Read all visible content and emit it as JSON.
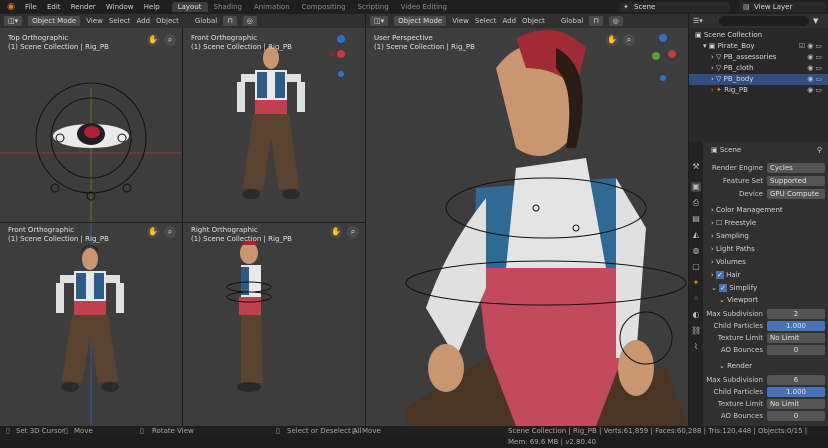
{
  "menu": [
    "File",
    "Edit",
    "Render",
    "Window",
    "Help"
  ],
  "workspaces": [
    {
      "label": "Layout",
      "active": true
    },
    {
      "label": "Shading",
      "active": false
    },
    {
      "label": "Animation",
      "active": false
    },
    {
      "label": "Compositing",
      "active": false
    },
    {
      "label": "Scripting",
      "active": false
    },
    {
      "label": "Video Editing",
      "active": false
    }
  ],
  "scene_name": "Scene",
  "view_layer": "View Layer",
  "viewport_header": {
    "mode": "Object Mode",
    "view": "View",
    "select": "Select",
    "add": "Add",
    "object": "Object",
    "orientation": "Global"
  },
  "viewports": {
    "top": {
      "name": "Top Orthographic",
      "collection": "(1) Scene Collection | Rig_PB"
    },
    "front": {
      "name": "Front Orthographic",
      "collection": "(1) Scene Collection | Rig_PB"
    },
    "front2": {
      "name": "Front Orthographic",
      "collection": "(1) Scene Collection | Rig_PB"
    },
    "right": {
      "name": "Right Orthographic",
      "collection": "(1) Scene Collection | Rig_PB"
    },
    "user": {
      "name": "User Perspective",
      "collection": "(1) Scene Collection | Rig_PB"
    }
  },
  "outliner": {
    "root": "Scene Collection",
    "items": [
      {
        "label": "Pirate_Boy",
        "selected": false
      },
      {
        "label": "PB_assessories",
        "selected": false
      },
      {
        "label": "PB_cloth",
        "selected": false
      },
      {
        "label": "PB_body",
        "selected": true
      },
      {
        "label": "Rig_PB",
        "selected": false
      }
    ]
  },
  "properties": {
    "context": "Scene",
    "render_engine_label": "Render Engine",
    "render_engine": "Cycles",
    "feature_set_label": "Feature Set",
    "feature_set": "Supported",
    "device_label": "Device",
    "device": "GPU Compute",
    "sections": {
      "color_management": "Color Management",
      "freestyle": "Freestyle",
      "sampling": "Sampling",
      "light_paths": "Light Paths",
      "volumes": "Volumes",
      "hair": "Hair",
      "simplify": "Simplify",
      "viewport": "Viewport",
      "render": "Render"
    },
    "viewport": {
      "max_subdiv_label": "Max Subdivision",
      "max_subdiv": "2",
      "child_particles_label": "Child Particles",
      "child_particles": "1.000",
      "texture_limit_label": "Texture Limit",
      "texture_limit": "No Limit",
      "ao_bounces_label": "AO Bounces",
      "ao_bounces": "0"
    },
    "render": {
      "max_subdiv_label": "Max Subdivision",
      "max_subdiv": "6",
      "child_particles_label": "Child Particles",
      "child_particles": "1.000",
      "texture_limit_label": "Texture Limit",
      "texture_limit": "No Limit",
      "ao_bounces_label": "AO Bounces",
      "ao_bounces": "0"
    }
  },
  "status": {
    "hint1": "Set 3D Cursor",
    "hint2": "Move",
    "hint3": "Rotate View",
    "hint4": "Select or Deselect All",
    "hint5": "Move",
    "stats": "Scene Collection | Rig_PB | Verts:61,859 | Faces:60,288 | Tris:120,448 | Objects:0/15 | Mem: 69.6 MB | v2.80.40"
  },
  "colors": {
    "accent": "#e87d0d",
    "selection": "#334d80",
    "field_blue": "#4772b3",
    "viewport_bg": "#3d3d3d"
  }
}
